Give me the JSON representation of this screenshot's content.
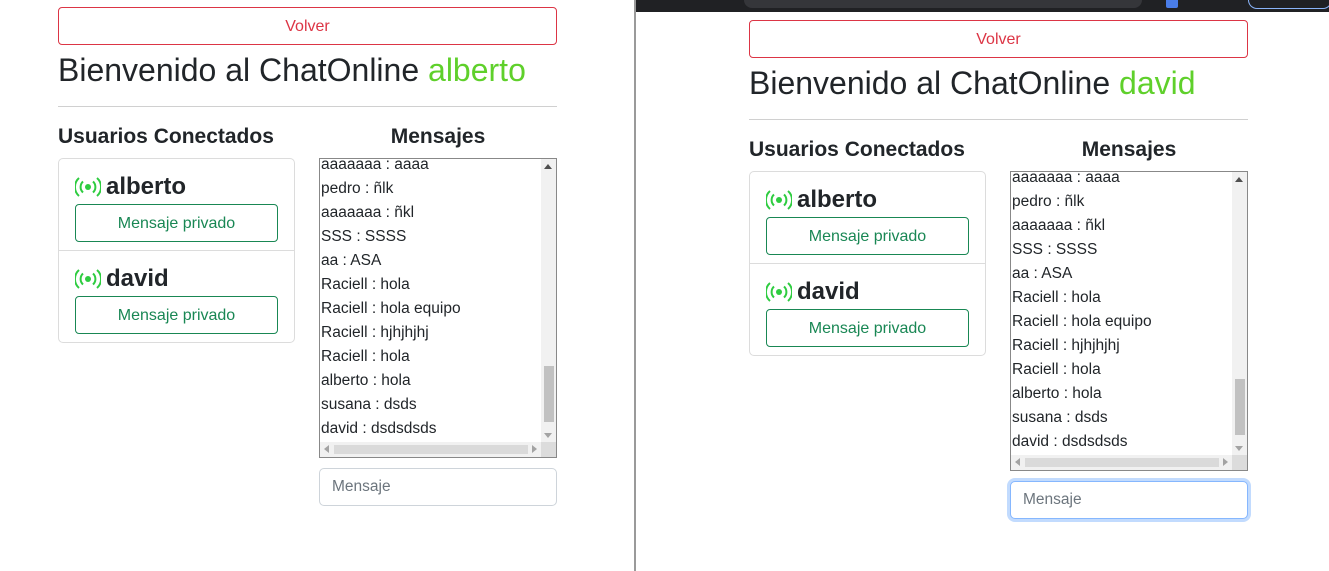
{
  "windows": [
    {
      "back_label": "Volver",
      "welcome_prefix": "Bienvenido al ChatOnline ",
      "current_user": "alberto",
      "users_title": "Usuarios Conectados",
      "messages_title": "Mensajes",
      "users": [
        {
          "name": "alberto",
          "button_label": "Mensaje privado"
        },
        {
          "name": "david",
          "button_label": "Mensaje privado"
        }
      ],
      "messages": [
        "aaaaaaa : aaaa",
        "pedro : ñlk",
        "aaaaaaa : ñkl",
        "SSS : SSSS",
        "aa : ASA",
        "Raciell : hola",
        "Raciell : hola equipo",
        "Raciell : hjhjhjhj",
        "Raciell : hola",
        "alberto : hola",
        "susana : dsds",
        "david : dsdsdsds"
      ],
      "input_placeholder": "Mensaje",
      "input_value": ""
    },
    {
      "back_label": "Volver",
      "welcome_prefix": "Bienvenido al ChatOnline ",
      "current_user": "david",
      "users_title": "Usuarios Conectados",
      "messages_title": "Mensajes",
      "users": [
        {
          "name": "alberto",
          "button_label": "Mensaje privado"
        },
        {
          "name": "david",
          "button_label": "Mensaje privado"
        }
      ],
      "messages": [
        "aaaaaaa : aaaa",
        "pedro : ñlk",
        "aaaaaaa : ñkl",
        "SSS : SSSS",
        "aa : ASA",
        "Raciell : hola",
        "Raciell : hola equipo",
        "Raciell : hjhjhjhj",
        "Raciell : hola",
        "alberto : hola",
        "susana : dsds",
        "david : dsdsdsds"
      ],
      "input_placeholder": "Mensaje",
      "input_value": ""
    }
  ],
  "colors": {
    "accent_user": "#5fd02b",
    "danger": "#dc3545",
    "success": "#198754",
    "live_icon": "#2ecc40"
  },
  "icons": {
    "online": "broadcast-live-icon"
  }
}
